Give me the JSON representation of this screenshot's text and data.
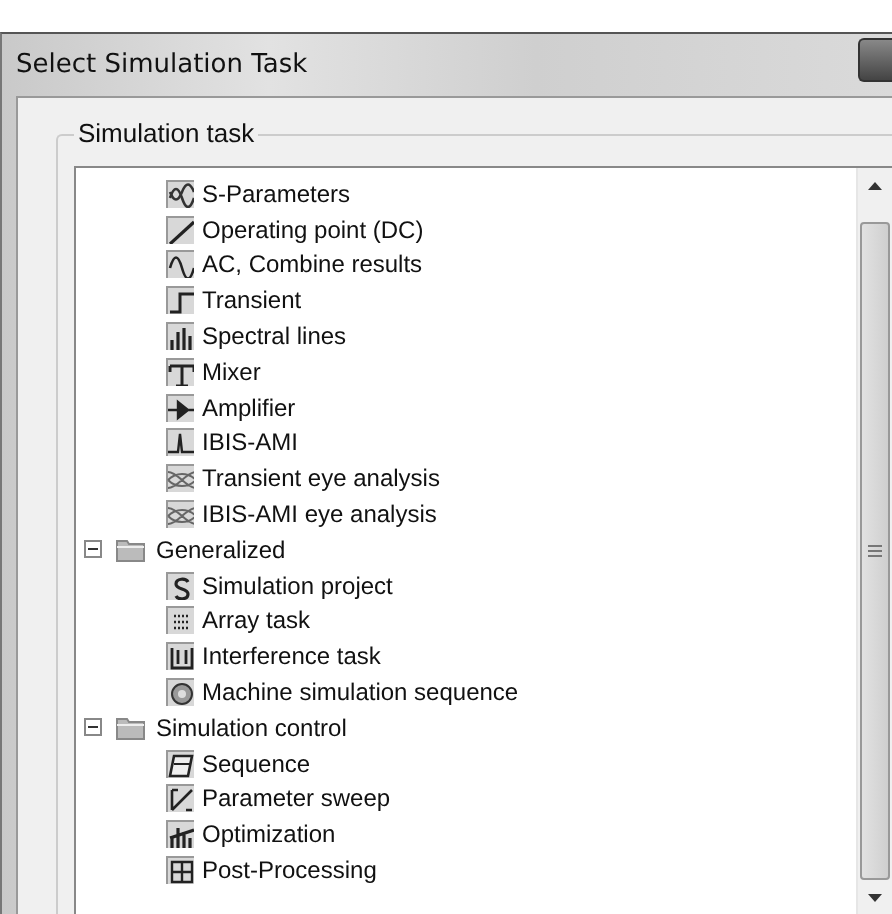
{
  "window": {
    "title": "Select Simulation Task"
  },
  "group": {
    "legend": "Simulation task"
  },
  "tree": [
    {
      "children": [
        {
          "label": "S-Parameters"
        },
        {
          "label": "Operating point (DC)"
        },
        {
          "label": "AC, Combine results"
        },
        {
          "label": "Transient"
        },
        {
          "label": "Spectral lines"
        },
        {
          "label": "Mixer"
        },
        {
          "label": "Amplifier"
        },
        {
          "label": "IBIS-AMI"
        },
        {
          "label": "Transient eye analysis"
        },
        {
          "label": "IBIS-AMI eye analysis"
        }
      ]
    },
    {
      "label": "Generalized",
      "expanded": true,
      "children": [
        {
          "label": "Simulation project"
        },
        {
          "label": "Array task"
        },
        {
          "label": "Interference task"
        },
        {
          "label": "Machine simulation sequence"
        }
      ]
    },
    {
      "label": "Simulation control",
      "expanded": true,
      "children": [
        {
          "label": "Sequence"
        },
        {
          "label": "Parameter sweep"
        },
        {
          "label": "Optimization"
        },
        {
          "label": "Post-Processing"
        }
      ]
    }
  ]
}
